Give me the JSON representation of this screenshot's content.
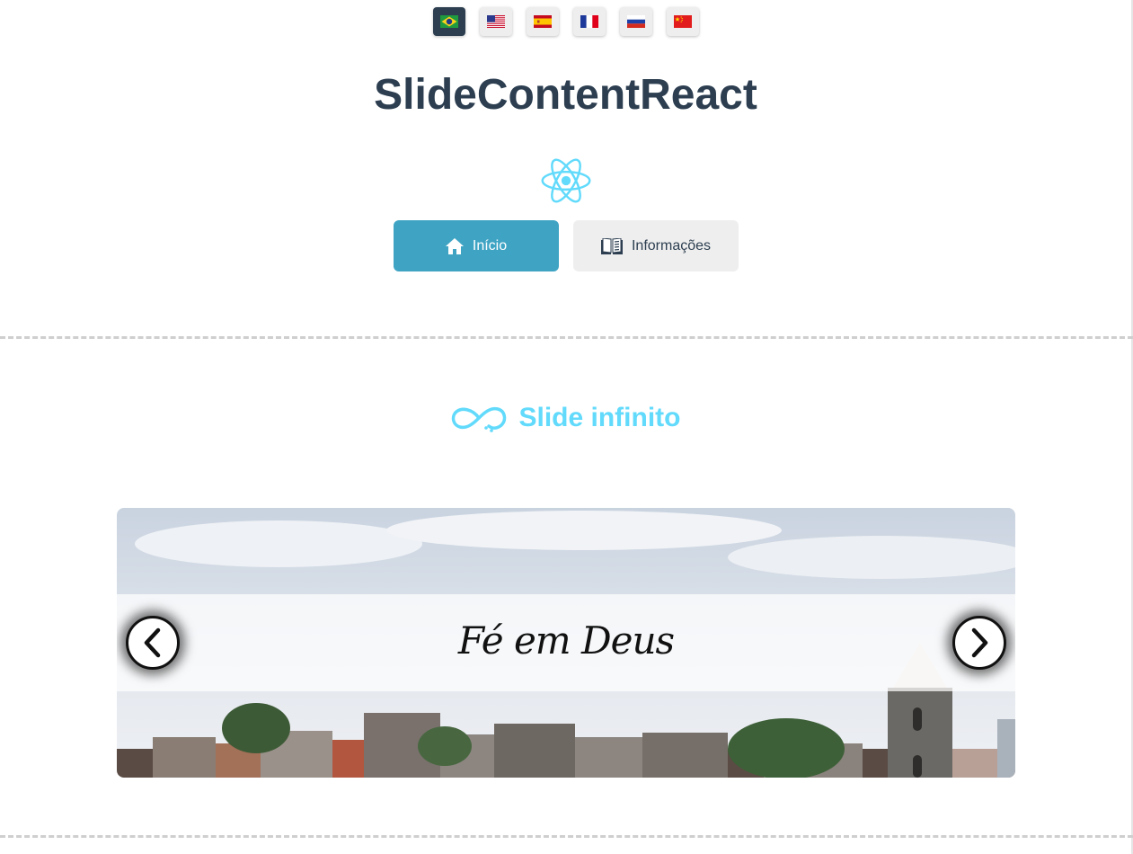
{
  "languages": [
    {
      "code": "pt-br",
      "icon": "flag-brazil-icon",
      "active": true
    },
    {
      "code": "en-us",
      "icon": "flag-usa-icon",
      "active": false
    },
    {
      "code": "es",
      "icon": "flag-spain-icon",
      "active": false
    },
    {
      "code": "fr",
      "icon": "flag-france-icon",
      "active": false
    },
    {
      "code": "ru",
      "icon": "flag-russia-icon",
      "active": false
    },
    {
      "code": "zh",
      "icon": "flag-china-icon",
      "active": false
    }
  ],
  "header": {
    "title": "SlideContentReact",
    "logo": "react-logo-icon"
  },
  "nav": {
    "home_label": "Início",
    "home_icon": "home-icon",
    "info_label": "Informações",
    "info_icon": "book-icon"
  },
  "section": {
    "title": "Slide infinito",
    "icon": "infinity-icon"
  },
  "slider": {
    "caption": "Fé em Deus",
    "prev_icon": "chevron-left-icon",
    "next_icon": "chevron-right-icon"
  },
  "colors": {
    "title": "#2c3e50",
    "primary_button": "#3fa4c4",
    "secondary_button": "#eeeeee",
    "accent": "#61dafb"
  }
}
